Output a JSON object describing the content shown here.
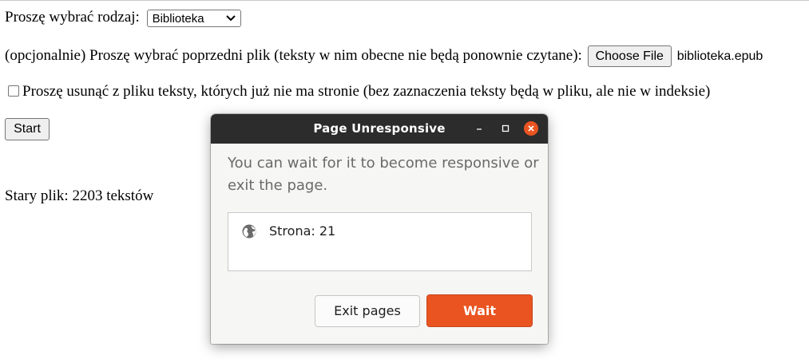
{
  "form": {
    "type_label": "Proszę wybrać rodzaj:",
    "type_select_value": "Biblioteka",
    "previous_file_label": "(opcjonalnie) Proszę wybrać poprzedni plik (teksty w nim obecne nie będą ponownie czytane):",
    "choose_file_label": "Choose File",
    "chosen_file_name": "biblioteka.epub",
    "remove_texts_checked": false,
    "remove_texts_label": "Proszę usunąć z pliku teksty, których już nie ma stronie (bez zaznaczenia teksty będą w pliku, ale nie w indeksie)",
    "start_label": "Start",
    "old_file_status": "Stary plik: 2203 tekstów"
  },
  "dialog": {
    "title": "Page Unresponsive",
    "message": "You can wait for it to become responsive or exit the page.",
    "pages": [
      {
        "icon": "globe-icon",
        "label": "Strona: 21"
      }
    ],
    "exit_label": "Exit pages",
    "wait_label": "Wait"
  },
  "colors": {
    "accent": "#e95420",
    "titlebar": "#2c2c2c"
  }
}
